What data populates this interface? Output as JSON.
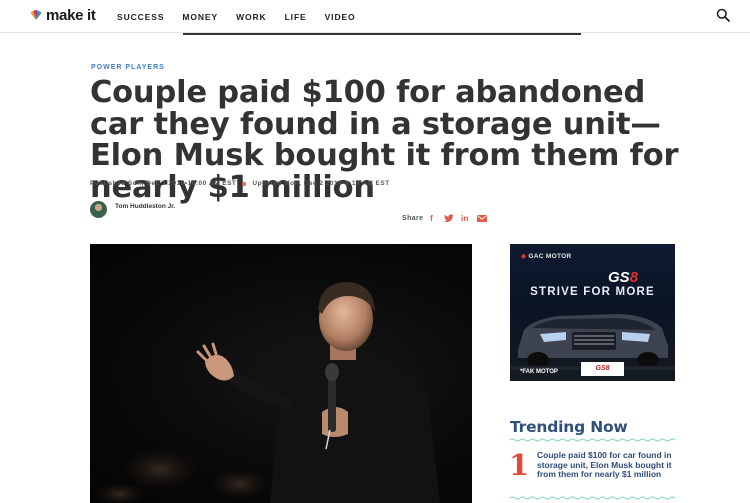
{
  "header": {
    "logo_text": "make it",
    "nav": [
      "SUCCESS",
      "MONEY",
      "WORK",
      "LIFE",
      "VIDEO"
    ],
    "search_icon": "search-icon"
  },
  "article": {
    "eyebrow": "POWER PLAYERS",
    "headline": "Couple paid $100 for abandoned car they found in a storage unit—Elon Musk bought it from them for nearly $1 million",
    "published": "Published Sun, Dec 1 2019•10:00 AM EST",
    "updated": "Updated Mon, Dec 2 2019•9:14 AM EST",
    "author": "Tom Huddleston Jr.",
    "share_label": "Share",
    "share_icons": [
      "facebook-icon",
      "twitter-icon",
      "linkedin-icon",
      "email-icon"
    ]
  },
  "ad": {
    "brand": "GAC MOTOR",
    "model": "GS",
    "model_accent": "8",
    "slogan": "STRIVE FOR MORE",
    "footer": "*FAK MOTOP",
    "badge": "GS8"
  },
  "trending": {
    "title": "Trending Now",
    "items": [
      {
        "rank": "1",
        "text": "Couple paid $100 for car found in storage unit, Elon Musk bought it from them for nearly $1 million"
      }
    ]
  },
  "colors": {
    "accent_blue": "#3e7cc7",
    "trending_blue": "#2f4f7e",
    "share_red": "#e25a4a",
    "rank_red": "#e04a3c"
  }
}
